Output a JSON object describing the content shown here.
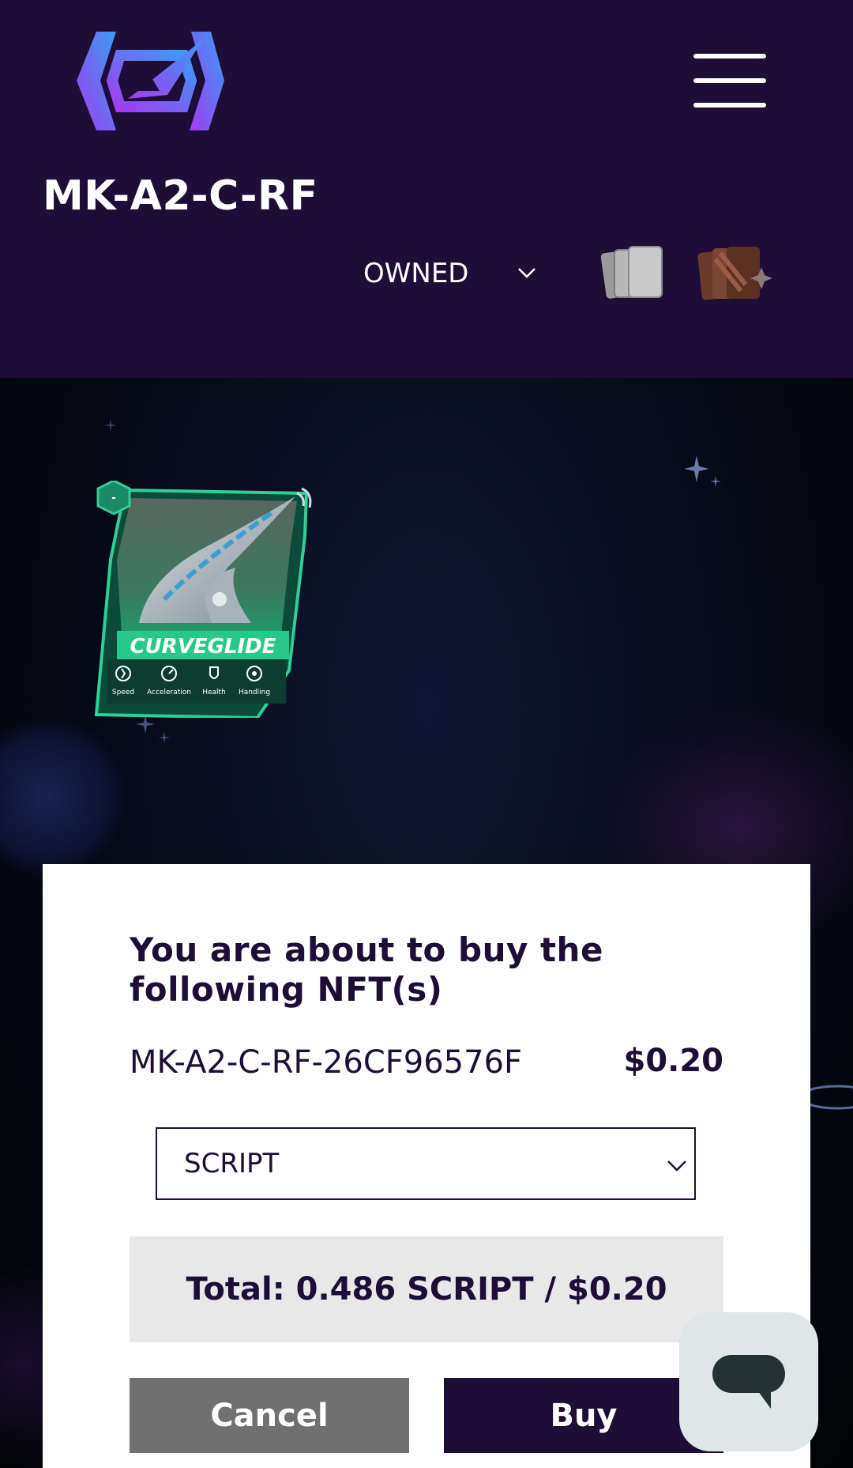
{
  "header": {
    "title": "MK-A2-C-RF",
    "filter": {
      "selected": "OWNED"
    },
    "icons": [
      "logo-icon",
      "menu-icon",
      "chevron-down-icon",
      "cards-icon",
      "card-packs-icon"
    ]
  },
  "nft_card": {
    "name": "CURVEGLIDE",
    "level": "-",
    "stats": [
      "Speed",
      "Acceleration",
      "Health",
      "Handling"
    ]
  },
  "modal": {
    "heading": "You are about to buy the following NFT(s)",
    "item": {
      "id": "MK-A2-C-RF-26CF96576F",
      "price": "$0.20"
    },
    "currency": {
      "selected": "SCRIPT"
    },
    "total": "Total: 0.486 SCRIPT / $0.20",
    "cancel_label": "Cancel",
    "buy_label": "Buy"
  },
  "chat": {
    "icon": "chat-bubble-icon"
  },
  "colors": {
    "header_bg": "#1d0d37",
    "primary": "#1d0d37",
    "cancel_bg": "#707070",
    "total_bg": "#e8e8e8",
    "card_accent": "#2fcf95",
    "logo_purple": "#8b3cf0",
    "logo_blue": "#3a8cf0"
  }
}
